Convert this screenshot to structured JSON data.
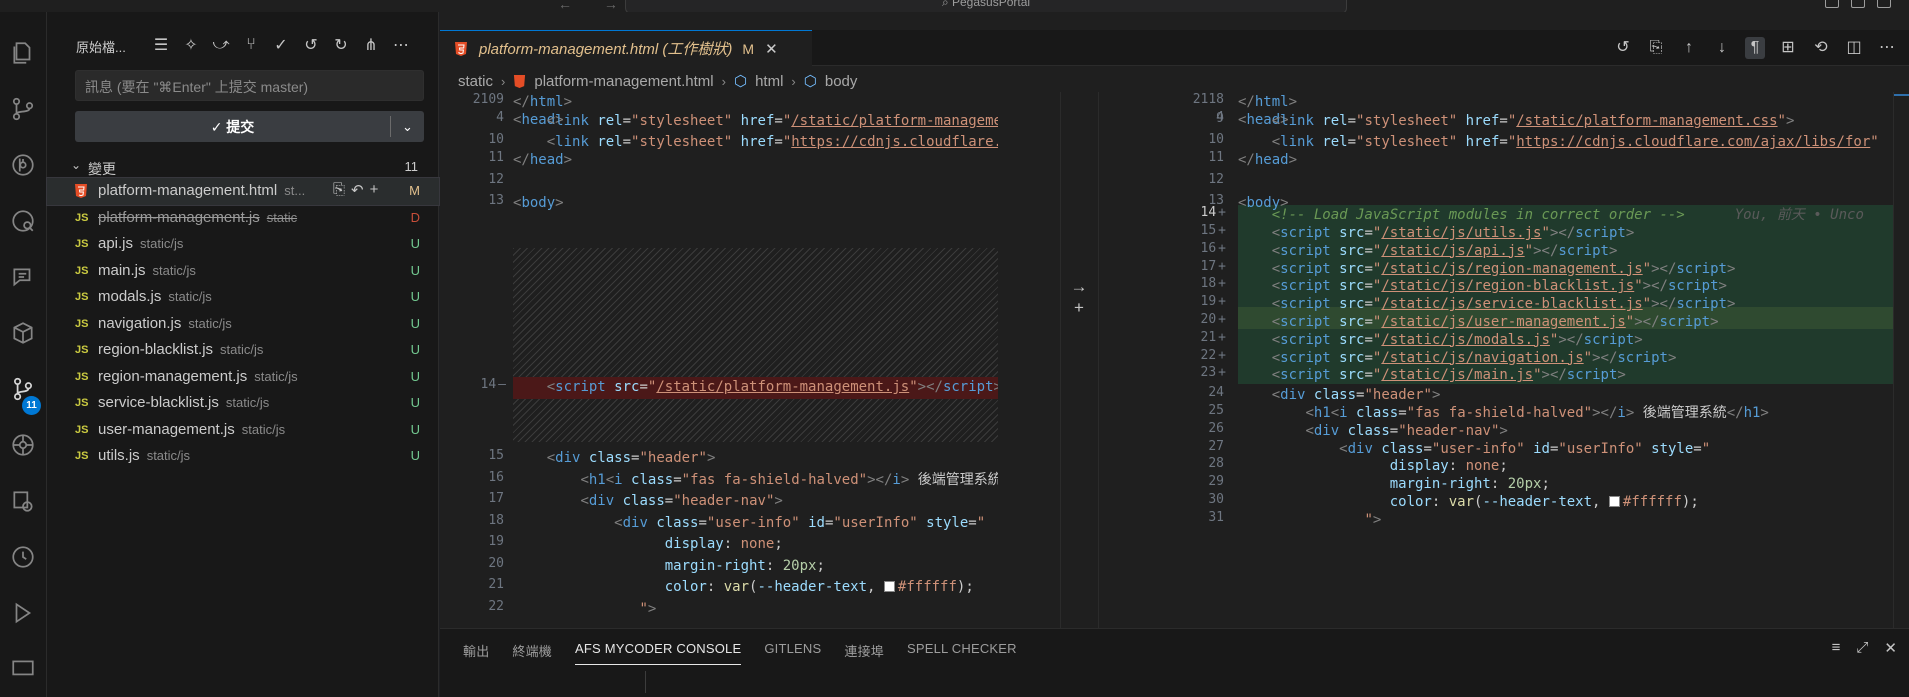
{
  "titlebar": {
    "nav": "← →",
    "command_center": "PegasusPortal"
  },
  "activity": {
    "scm_badge": "11"
  },
  "sidebar": {
    "title": "原始檔...",
    "commit_placeholder": "訊息 (要在 \"⌘Enter\" 上提交 master)",
    "commit_label": "✓ 提交",
    "changes_label": "變更",
    "changes_count": "11",
    "files": [
      {
        "name": "platform-management.html",
        "path": "st...",
        "status": "M",
        "type": "html",
        "selected": true
      },
      {
        "name": "platform-management.js",
        "path": "static",
        "status": "D",
        "type": "js",
        "deleted": true
      },
      {
        "name": "api.js",
        "path": "static/js",
        "status": "U",
        "type": "js"
      },
      {
        "name": "main.js",
        "path": "static/js",
        "status": "U",
        "type": "js"
      },
      {
        "name": "modals.js",
        "path": "static/js",
        "status": "U",
        "type": "js"
      },
      {
        "name": "navigation.js",
        "path": "static/js",
        "status": "U",
        "type": "js"
      },
      {
        "name": "region-blacklist.js",
        "path": "static/js",
        "status": "U",
        "type": "js"
      },
      {
        "name": "region-management.js",
        "path": "static/js",
        "status": "U",
        "type": "js"
      },
      {
        "name": "service-blacklist.js",
        "path": "static/js",
        "status": "U",
        "type": "js"
      },
      {
        "name": "user-management.js",
        "path": "static/js",
        "status": "U",
        "type": "js"
      },
      {
        "name": "utils.js",
        "path": "static/js",
        "status": "U",
        "type": "js"
      }
    ]
  },
  "editor": {
    "tab_title": "platform-management.html (工作樹狀)",
    "tab_status": "M",
    "breadcrumb": [
      "static",
      "platform-management.html",
      "html",
      "body"
    ],
    "blame": "You, 前天 • Unco",
    "left_lines": [
      "2109",
      "4",
      "10",
      "11",
      "12",
      "13",
      "14",
      "15",
      "16",
      "17",
      "18",
      "19",
      "20",
      "21",
      "22"
    ],
    "right_lines": [
      "2118",
      "4",
      "9",
      "10",
      "11",
      "12",
      "13",
      "14",
      "15",
      "16",
      "17",
      "18",
      "19",
      "20",
      "21",
      "22",
      "23",
      "24",
      "25",
      "26",
      "27",
      "28",
      "29",
      "30",
      "31"
    ],
    "script_files": [
      "/static/js/utils.js",
      "/static/js/api.js",
      "/static/js/region-management.js",
      "/static/js/region-blacklist.js",
      "/static/js/service-blacklist.js",
      "/static/js/user-management.js",
      "/static/js/modals.js",
      "/static/js/navigation.js",
      "/static/js/main.js"
    ],
    "deleted_script": "/static/platform-management.js",
    "css_link": "/static/platform-management.css",
    "cdn_link_left": "https://cdnjs.cloudflare.com/ajax/lib",
    "cdn_link_right": "https://cdnjs.cloudflare.com/ajax/libs/for",
    "comment": "<!-- Load JavaScript modules in correct order -->",
    "header_title": "後端管理系統",
    "color_value": "#ffffff"
  },
  "panel": {
    "tabs": [
      "輸出",
      "終端機",
      "AFS MYCODER CONSOLE",
      "GITLENS",
      "連接埠",
      "SPELL CHECKER"
    ],
    "active_tab": "AFS MYCODER CONSOLE"
  }
}
